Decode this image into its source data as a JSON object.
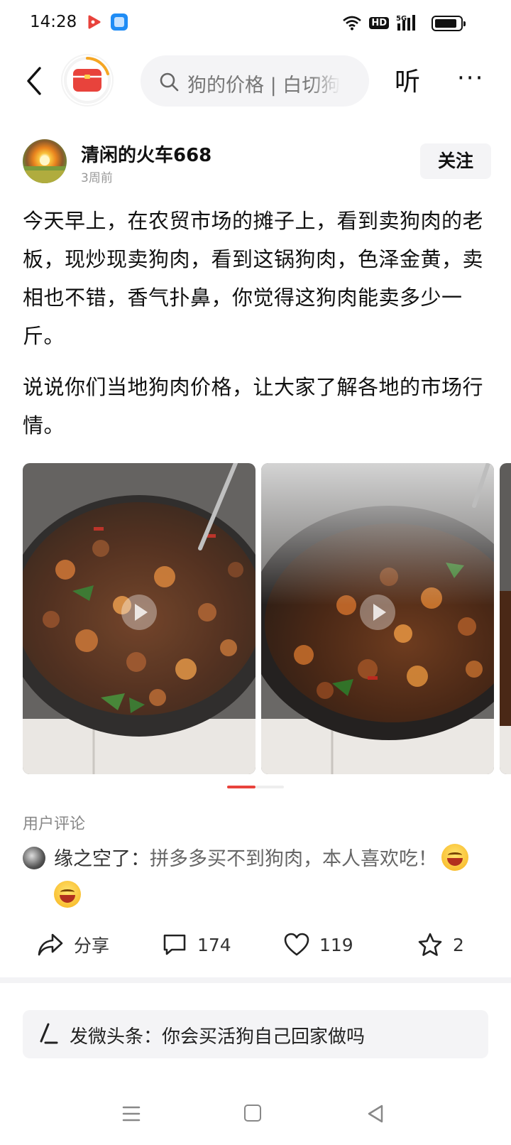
{
  "status_bar": {
    "time": "14:28",
    "hd_badge": "HD",
    "network": "5G",
    "icons": [
      "video-app-icon",
      "browser-app-icon",
      "wifi-icon",
      "hd-icon",
      "signal-5g-icon",
      "battery-icon"
    ]
  },
  "header": {
    "search_placeholder": "狗的价格 | 白切狗",
    "listen_label": "听",
    "more_label": "···",
    "colors": {
      "logo_red": "#e8433c",
      "logo_orange": "#f5a623",
      "search_bg": "#f4f4f6"
    }
  },
  "author": {
    "name": "清闲的火车668",
    "time_ago": "3周前",
    "follow_label": "关注"
  },
  "post": {
    "paragraphs": [
      "今天早上，在农贸市场的摊子上，看到卖狗肉的老板，现炒现卖狗肉，看到这锅狗肉，色泽金黄，卖相也不错，香气扑鼻，你觉得这狗肉能卖多少一斤。",
      "说说你们当地狗肉价格，让大家了解各地的市场行情。"
    ],
    "images": [
      "stir-fried-meat-wok-video-1",
      "stir-fried-meat-wok-video-2",
      "partial-image-3"
    ],
    "page_indicator": {
      "current": 1,
      "total": 2
    }
  },
  "comments": {
    "section_label": "用户评论",
    "items": [
      {
        "user": "缘之空了",
        "separator": "：",
        "text": "拼多多买不到狗肉，本人喜欢吃！",
        "emojis": [
          "laughing-emoji",
          "laughing-emoji"
        ]
      }
    ]
  },
  "actions": {
    "share_label": "分享",
    "comment_count": "174",
    "like_count": "119",
    "favorite_count": "2"
  },
  "bottom_bar": {
    "prompt": "发微头条：你会买活狗自己回家做吗"
  },
  "nav_bar": {
    "icons": [
      "menu-icon",
      "home-icon",
      "back-triangle-icon"
    ]
  },
  "colors": {
    "accent_red": "#e8433c",
    "text_primary": "#111111",
    "text_secondary": "#888888",
    "surface": "#f4f4f6"
  }
}
